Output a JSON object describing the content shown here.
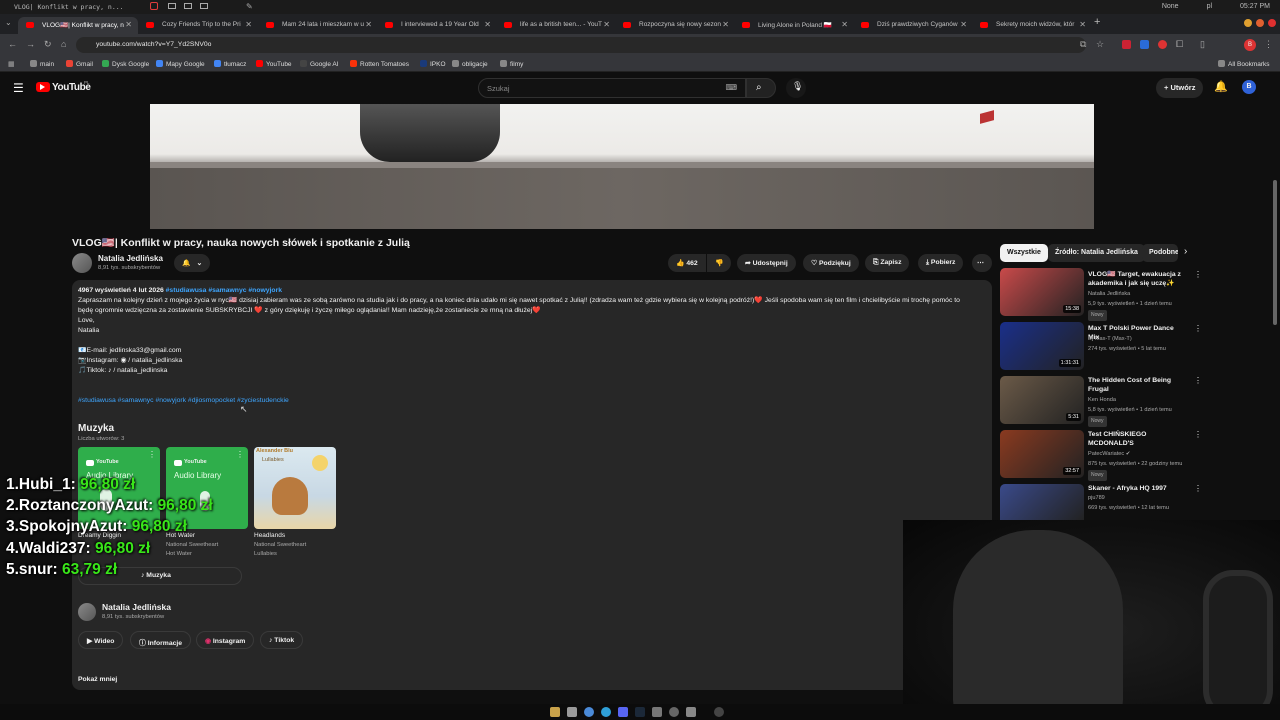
{
  "os": {
    "window_title": "VLOG| Konflikt w pracy, n...",
    "tray_none": "None",
    "lang": "pl",
    "clock": "05:27 PM"
  },
  "tabs": [
    {
      "label": "VLOG🇺🇸| Konflikt w pracy, n"
    },
    {
      "label": "Cozy Friends Trip to the Pri"
    },
    {
      "label": "Mam 24 lata i mieszkam w u"
    },
    {
      "label": "I interviewed a 19 Year Old"
    },
    {
      "label": "life as a british teen... - YouT"
    },
    {
      "label": "Rozpoczyna się nowy sezon"
    },
    {
      "label": "Living Alone in Poland 🇵🇱"
    },
    {
      "label": "Dziś prawdziwych Cyganów"
    },
    {
      "label": "Sekrety moich widzów, któr"
    }
  ],
  "browser": {
    "url": "youtube.com/watch?v=Y7_Yd2SNV0o",
    "all_bookmarks": "All Bookmarks",
    "bookmarks": [
      {
        "label": "main",
        "color": "#888888"
      },
      {
        "label": "Gmail",
        "color": "#ea4335"
      },
      {
        "label": "Dysk Google",
        "color": "#34a853"
      },
      {
        "label": "Mapy Google",
        "color": "#4285f4"
      },
      {
        "label": "tłumacz",
        "color": "#4285f4"
      },
      {
        "label": "YouTube",
        "color": "#ff0000"
      },
      {
        "label": "Google AI",
        "color": "#222222"
      },
      {
        "label": "Rotten Tomatoes",
        "color": "#fa320a"
      },
      {
        "label": "IPKO",
        "color": "#1a3a7a"
      },
      {
        "label": "obligacje",
        "color": "#888888"
      },
      {
        "label": "filmy",
        "color": "#888888"
      }
    ]
  },
  "yt": {
    "logo": "YouTube",
    "logo_sup": "PL",
    "search_placeholder": "Szukaj",
    "create_label": "Utwórz",
    "avatar_letter": "B"
  },
  "video": {
    "title": "VLOG🇺🇸| Konflikt w pracy, nauka nowych słówek i spotkanie z Julią",
    "channel": "Natalia Jedlińska",
    "subs": "8,91 tys. subskrybentów",
    "likes": "462",
    "share": "Udostępnij",
    "thanks": "Podziękuj",
    "save": "Zapisz",
    "download": "Pobierz"
  },
  "description": {
    "stats": "4967 wyświetleń  4 lut 2026",
    "stats_tags": "#studiawusa #samawnyc #nowyjork",
    "line1": "Zapraszam na kolejny dzień z mojego życia w nyc🇺🇸 dzisiaj zabieram was ze sobą zarówno na studia jak i do pracy, a na koniec dnia udało mi się nawet spotkać z Julią!! (zdradza wam też gdzie wybiera się w kolejną podróż!)❤️ Jeśli spodoba wam się ten film i chcielibyście mi trochę pomóc to",
    "line2": "będę ogromnie wdzięczna za zostawienie SUBSKRYBCJI ❤️ z góry dziękuję i życzę miłego oglądania!! Mam nadzieję,że zostaniecie ze mną na dłużej❤️",
    "line3": "Love,",
    "line4": "Natalia",
    "email": "📧E-mail: jedlinska33@gmail.com",
    "instagram": "📷Instagram:  ◉ / natalia_jedlinska",
    "tiktok": "🎵Tiktok:  ♪ / natalia_jedlinska",
    "hashtags": "#studiawusa #samawnyc #nowyjork #djiosmopocket #zyciestudenckie",
    "music_heading": "Muzyka",
    "music_count": "Liczba utworów: 3",
    "music_button": "Muzyka",
    "channel_name": "Natalia Jedlińska",
    "channel_subs": "8,91 tys. subskrybentów",
    "btn_video": "Wideo",
    "btn_info": "Informacje",
    "btn_instagram": "Instagram",
    "btn_tiktok": "Tiktok",
    "show_less": "Pokaż mniej"
  },
  "music": [
    {
      "card_brand": "YouTube",
      "card_lib": "Audio Library",
      "title": "Dreamy Diggin",
      "artist": ""
    },
    {
      "card_brand": "YouTube",
      "card_lib": "Audio Library",
      "title": "Hot Water",
      "artist": "National Sweetheart\nHot Water"
    },
    {
      "card_brand": "Alexander Blu",
      "card_lib": "Lullabies",
      "title": "Headlands",
      "artist": "National Sweetheart\nLullabies"
    }
  ],
  "sidebar": {
    "chips": [
      "Wszystkie",
      "Źródło: Natalia Jedlińska",
      "Podobne"
    ],
    "videos": [
      {
        "title": "VLOG🇺🇸 Target, ewakuacja z akademika i jak się uczę✨",
        "channel": "Natalia Jedlińska",
        "meta": "5,9 tys. wyświetleń • 1 dzień temu",
        "badge": "Nowy",
        "duration": "15:38",
        "thumb_color": "#c94a4a"
      },
      {
        "title": "Max T Polski Power Dance Mix",
        "channel": "Dj Max-T (Max-T)",
        "meta": "274 tys. wyświetleń • 5 lat temu",
        "badge": "",
        "duration": "1:31:31",
        "thumb_color": "#1a2f8a"
      },
      {
        "title": "The Hidden Cost of Being Frugal",
        "channel": "Ken Honda",
        "meta": "5,8 tys. wyświetleń • 1 dzień temu",
        "badge": "Nowy",
        "duration": "5:31",
        "thumb_color": "#6b5a48"
      },
      {
        "title": "Test CHIŃSKIEGO MCDONALD'S",
        "channel": "PatecWariatec ✔",
        "meta": "875 tys. wyświetleń • 22 godziny temu",
        "badge": "Nowy",
        "duration": "32:57",
        "thumb_color": "#8a3a20"
      },
      {
        "title": "Skaner - Afryka HQ 1997",
        "channel": "pju789",
        "meta": "669 tys. wyświetleń • 12 lat temu",
        "badge": "",
        "duration": "",
        "thumb_color": "#3a4a8a"
      }
    ]
  },
  "leaderboard": [
    {
      "name": "1.Hubi_1:",
      "amount": "96,80 zł"
    },
    {
      "name": "2.RoztanczonyAzut:",
      "amount": "96,80 zł"
    },
    {
      "name": "3.SpokojnyAzut:",
      "amount": "96,80 zł"
    },
    {
      "name": "4.Waldi237:",
      "amount": "96,80 zł"
    },
    {
      "name": "5.snur:",
      "amount": "63,79 zł"
    }
  ]
}
